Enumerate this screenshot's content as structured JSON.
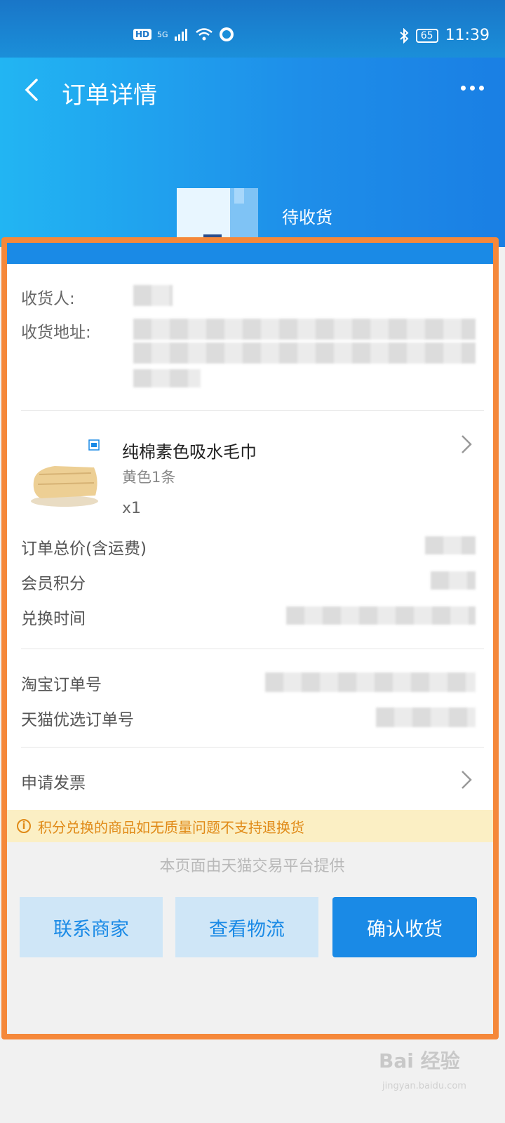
{
  "status_bar": {
    "hd": "HD",
    "net": "5G",
    "battery": "65",
    "time": "11:39"
  },
  "header": {
    "title": "订单详情",
    "status": "待收货"
  },
  "recipient": {
    "name_label": "收货人:",
    "address_label": "收货地址:"
  },
  "product": {
    "name": "纯棉素色吸水毛巾",
    "variant": "黄色1条",
    "quantity": "x1"
  },
  "order_info": {
    "total_label": "订单总价(含运费)",
    "points_label": "会员积分",
    "time_label": "兑换时间"
  },
  "order_numbers": {
    "taobao_label": "淘宝订单号",
    "tmall_label": "天猫优选订单号"
  },
  "invoice": {
    "label": "申请发票"
  },
  "notice": {
    "text": "积分兑换的商品如无质量问题不支持退换货",
    "icon_text": "i"
  },
  "provider": {
    "text": "本页面由天猫交易平台提供"
  },
  "actions": {
    "contact": "联系商家",
    "logistics": "查看物流",
    "confirm": "确认收货"
  },
  "watermark": {
    "text": "Bai 经验",
    "sub": "jingyan.baidu.com"
  },
  "colors": {
    "accent": "#1a8ae6",
    "highlight": "#f5883a",
    "notice_bg": "#fbefc4"
  }
}
